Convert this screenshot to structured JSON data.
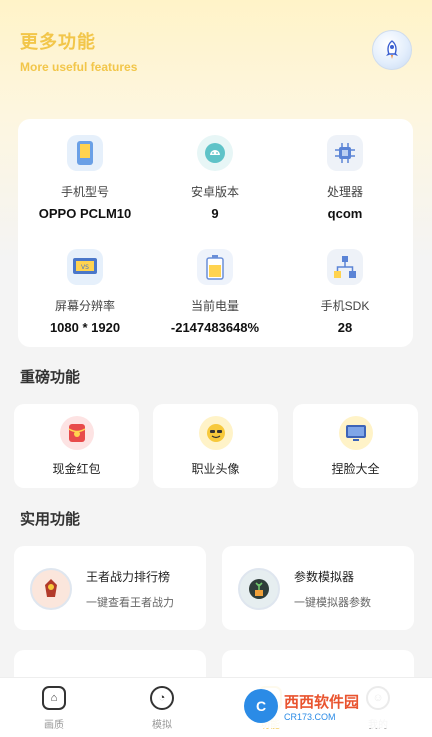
{
  "header": {
    "title": "更多功能",
    "subtitle": "More useful features",
    "rocket_icon": "rocket-icon"
  },
  "device_info": [
    {
      "label": "手机型号",
      "value": "OPPO PCLM10",
      "icon": "phone-icon"
    },
    {
      "label": "安卓版本",
      "value": "9",
      "icon": "android-icon"
    },
    {
      "label": "处理器",
      "value": "qcom",
      "icon": "chip-icon"
    },
    {
      "label": "屏幕分辨率",
      "value": "1080 * 1920",
      "icon": "screen-icon"
    },
    {
      "label": "当前电量",
      "value": "-2147483648%",
      "icon": "battery-icon"
    },
    {
      "label": "手机SDK",
      "value": "28",
      "icon": "sdk-icon"
    }
  ],
  "featured": {
    "title": "重磅功能",
    "items": [
      {
        "label": "现金红包",
        "icon": "red-envelope-icon"
      },
      {
        "label": "职业头像",
        "icon": "avatar-icon"
      },
      {
        "label": "捏脸大全",
        "icon": "face-icon"
      }
    ]
  },
  "utility": {
    "title": "实用功能",
    "items": [
      {
        "title": "王者战力排行榜",
        "subtitle": "一键查看王者战力",
        "icon": "warrior-icon"
      },
      {
        "title": "参数模拟器",
        "subtitle": "一键模拟器参数",
        "icon": "plant-icon"
      },
      {
        "title": "",
        "subtitle": "",
        "icon": "partial-card-icon"
      },
      {
        "title": "",
        "subtitle": "",
        "icon": "partial-card-icon"
      }
    ]
  },
  "nav": {
    "items": [
      {
        "label": "画质",
        "icon": "home-icon"
      },
      {
        "label": "模拟",
        "icon": "chart-icon"
      },
      {
        "label": "功能",
        "icon": "function-icon"
      },
      {
        "label": "我的",
        "icon": "user-icon"
      }
    ],
    "active_index": 2
  },
  "watermark": {
    "text": "西西软件园",
    "sub": "CR173.COM"
  },
  "colors": {
    "accent": "#f2c64a",
    "card_bg": "#ffffff",
    "page_bg": "#f4f4f4"
  }
}
